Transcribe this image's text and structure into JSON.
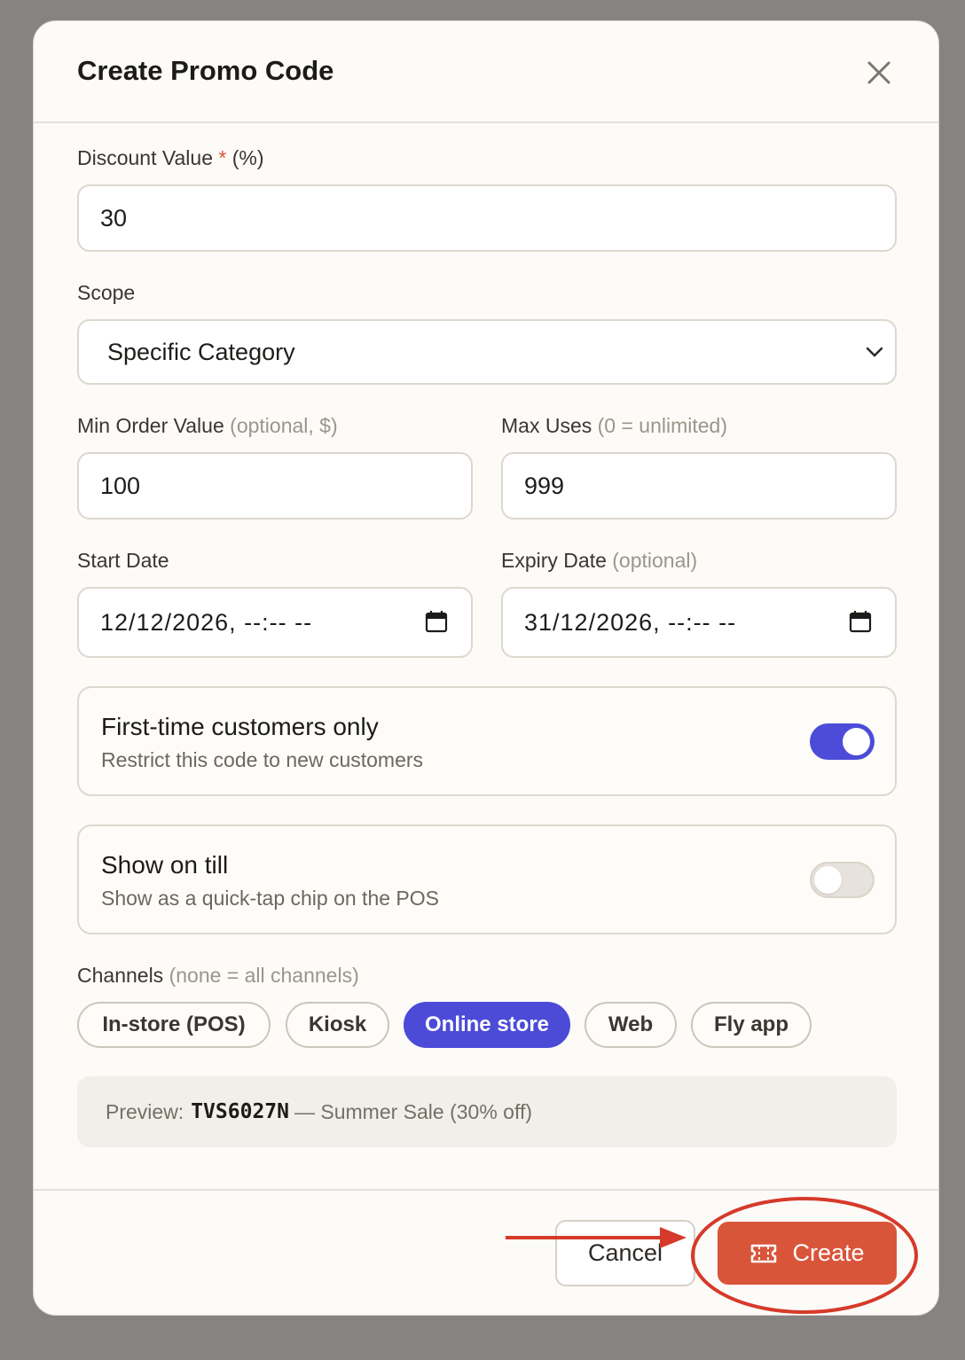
{
  "modal": {
    "title": "Create Promo Code"
  },
  "discount": {
    "label": "Discount Value",
    "required_mark": "*",
    "unit": "(%)",
    "value": "30"
  },
  "scope": {
    "label": "Scope",
    "value": "Specific Category"
  },
  "min_order": {
    "label": "Min Order Value",
    "hint": "(optional, $)",
    "value": "100"
  },
  "max_uses": {
    "label": "Max Uses",
    "hint": "(0 = unlimited)",
    "value": "999"
  },
  "start_date": {
    "label": "Start Date",
    "value": "12/12/2026, --:-- --"
  },
  "expiry_date": {
    "label": "Expiry Date",
    "hint": "(optional)",
    "value": "31/12/2026, --:-- --"
  },
  "first_time": {
    "title": "First-time customers only",
    "subtitle": "Restrict this code to new customers",
    "enabled": true
  },
  "show_on_till": {
    "title": "Show on till",
    "subtitle": "Show as a quick-tap chip on the POS",
    "enabled": false
  },
  "channels": {
    "label": "Channels",
    "hint": "(none = all channels)",
    "items": [
      {
        "label": "In-store (POS)",
        "selected": false
      },
      {
        "label": "Kiosk",
        "selected": false
      },
      {
        "label": "Online store",
        "selected": true
      },
      {
        "label": "Web",
        "selected": false
      },
      {
        "label": "Fly app",
        "selected": false
      }
    ]
  },
  "preview": {
    "prefix": "Preview:",
    "code": "TVS6027N",
    "suffix": "— Summer Sale (30% off)"
  },
  "footer": {
    "cancel_label": "Cancel",
    "create_label": "Create"
  },
  "colors": {
    "accent": "#4b4bd8",
    "primary_action": "#d9553a",
    "annotation": "#d63a2a"
  }
}
